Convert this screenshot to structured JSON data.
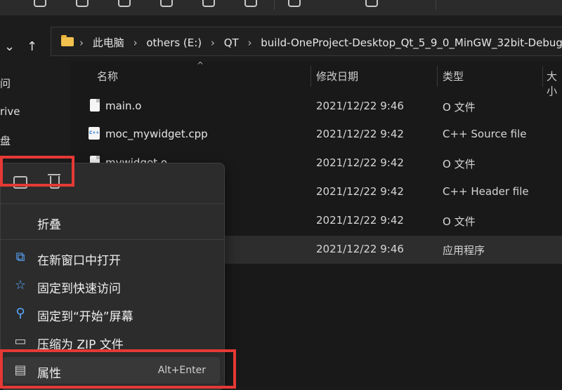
{
  "address": {
    "crumbs": [
      "此电脑",
      "others (E:)",
      "QT",
      "build-OneProject-Desktop_Qt_5_9_0_MinGW_32bit-Debug"
    ]
  },
  "sidebar": {
    "items": [
      "问",
      "rive",
      "盘"
    ]
  },
  "columns": {
    "name": "名称",
    "modified": "修改日期",
    "type": "类型",
    "size": "大小"
  },
  "files": [
    {
      "name": "main.o",
      "modified": "2021/12/22 9:46",
      "type": "O 文件"
    },
    {
      "name": "moc_mywidget.cpp",
      "modified": "2021/12/22 9:42",
      "type": "C++ Source file"
    },
    {
      "name": "mywidget.o",
      "modified": "2021/12/22 9:42",
      "type": "O 文件"
    },
    {
      "name": "",
      "modified": "2021/12/22 9:42",
      "type": "C++ Header file"
    },
    {
      "name": "",
      "modified": "2021/12/22 9:42",
      "type": "O 文件"
    },
    {
      "name": "",
      "modified": "2021/12/22 9:46",
      "type": "应用程序"
    }
  ],
  "menu": {
    "collapse_label": "折叠",
    "open_new_window": "在新窗口中打开",
    "pin_quick_access": "固定到快速访问",
    "pin_start": "固定到“开始”屏幕",
    "compress_zip": "压缩为 ZIP 文件",
    "properties": "属性",
    "properties_shortcut": "Alt+Enter"
  },
  "colors": {
    "accent": "#59a8ff",
    "highlight": "#e53935",
    "menu_bg": "#2c2c2c"
  }
}
